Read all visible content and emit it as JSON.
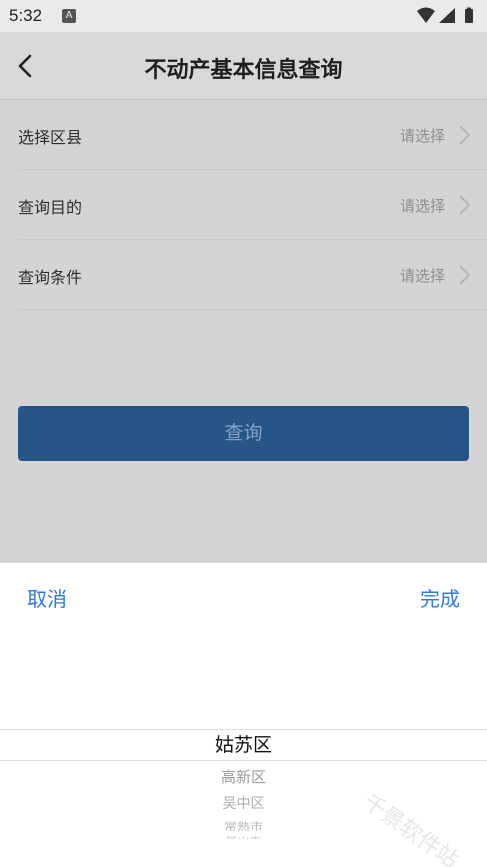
{
  "status_bar": {
    "time": "5:32",
    "notification_icon": "A",
    "icons": [
      "wifi-icon",
      "signal-icon",
      "battery-icon"
    ]
  },
  "header": {
    "back_icon": "chevron-left-icon",
    "title": "不动产基本信息查询"
  },
  "form": {
    "rows": [
      {
        "label": "选择区县",
        "value": "请选择"
      },
      {
        "label": "查询目的",
        "value": "请选择"
      },
      {
        "label": "查询条件",
        "value": "请选择"
      }
    ]
  },
  "query_button": {
    "label": "查询"
  },
  "picker": {
    "cancel_label": "取消",
    "done_label": "完成",
    "selected": "姑苏区",
    "options": [
      "高新区",
      "吴中区",
      "常熟市",
      "昆山市"
    ]
  },
  "watermark": "千景软件站",
  "colors": {
    "accent": "#2e7bd6",
    "button": "#2b5d92"
  }
}
